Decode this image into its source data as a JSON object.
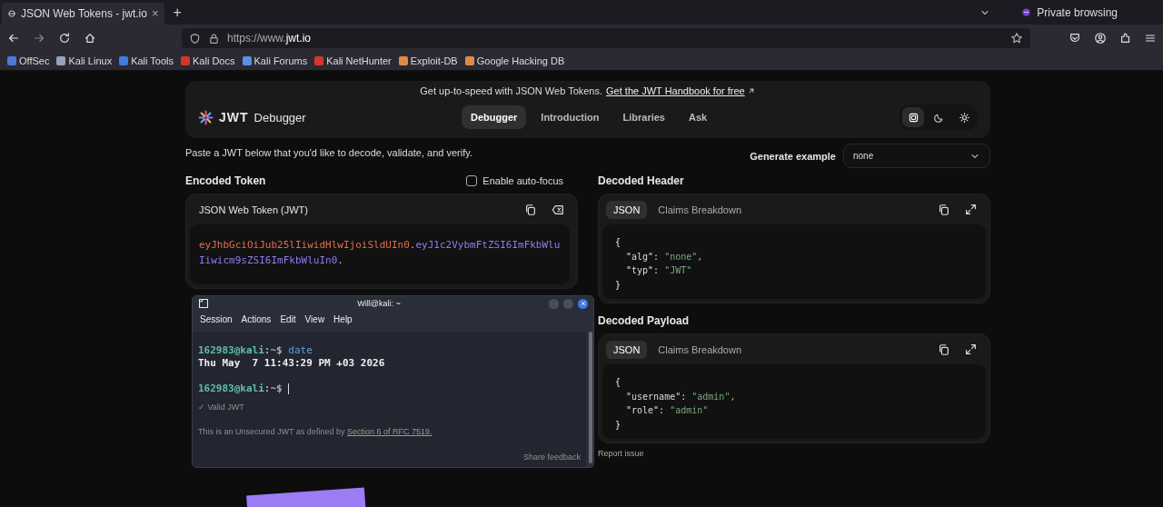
{
  "browser": {
    "tab": {
      "title": "JSON Web Tokens - jwt.io",
      "close": "×",
      "selected": true
    },
    "new_tab": "+",
    "private_label": "Private browsing",
    "url": {
      "prefix": "https://www.",
      "domain": "jwt.io"
    },
    "bookmarks": [
      {
        "label": "OffSec",
        "color": "#4a7bd8"
      },
      {
        "label": "Kali Linux",
        "color": "#9aa3b5"
      },
      {
        "label": "Kali Tools",
        "color": "#3f7be0"
      },
      {
        "label": "Kali Docs",
        "color": "#d9342b"
      },
      {
        "label": "Kali Forums",
        "color": "#5b8fe0"
      },
      {
        "label": "Kali NetHunter",
        "color": "#d9342b"
      },
      {
        "label": "Exploit-DB",
        "color": "#e08a4a"
      },
      {
        "label": "Google Hacking DB",
        "color": "#e08a4a"
      }
    ]
  },
  "banner": {
    "text": "Get up-to-speed with JSON Web Tokens.",
    "link": "Get the JWT Handbook for free"
  },
  "header": {
    "logo": "JWT",
    "title": "Debugger",
    "nav": [
      {
        "label": "Debugger",
        "selected": true
      },
      {
        "label": "Introduction",
        "selected": false
      },
      {
        "label": "Libraries",
        "selected": false
      },
      {
        "label": "Ask",
        "selected": false
      }
    ],
    "theme_buttons": [
      {
        "kind": "system",
        "selected": true
      },
      {
        "kind": "dark",
        "selected": false
      },
      {
        "kind": "light",
        "selected": false
      }
    ]
  },
  "intro": "Paste a JWT below that you'd like to decode, validate, and verify.",
  "generate": {
    "label": "Generate example",
    "value": "none"
  },
  "encoded": {
    "title": "Encoded Token",
    "autofocus": {
      "label": "Enable auto-focus",
      "checked": false
    },
    "panel_title": "JSON Web Token (JWT)",
    "token": [
      {
        "kind": "header",
        "text": "eyJhbGciOiJub25lIiwidHlwIjoiSldUIn0"
      },
      {
        "kind": "dot",
        "text": "."
      },
      {
        "kind": "payload",
        "text": "eyJ1c2VybmFtZSI6ImFkbWluIiwicm9sZSI6ImFkbWluIn0"
      },
      {
        "kind": "dot",
        "text": "."
      }
    ],
    "status": "✓ Valid JWT",
    "note": {
      "text": "This is an Unsecured JWT as defined by",
      "link": "Section 6 of RFC 7519."
    },
    "share_feedback": "Share feedback"
  },
  "decoded_header": {
    "title": "Decoded Header",
    "tabs": [
      {
        "label": "JSON",
        "selected": true
      },
      {
        "label": "Claims Breakdown",
        "selected": false
      }
    ],
    "lines": [
      {
        "kind": "brace",
        "text": "{"
      },
      {
        "kind": "entry",
        "key": "\"alg\":",
        "value": "\"none\"",
        "comma": ","
      },
      {
        "kind": "entry",
        "key": "\"typ\":",
        "value": "\"JWT\""
      },
      {
        "kind": "brace",
        "text": "}"
      }
    ]
  },
  "decoded_payload": {
    "title": "Decoded Payload",
    "tabs": [
      {
        "label": "JSON",
        "selected": true
      },
      {
        "label": "Claims Breakdown",
        "selected": false
      }
    ],
    "lines": [
      {
        "kind": "brace",
        "text": "{"
      },
      {
        "kind": "entry",
        "key": "\"username\":",
        "value": "\"admin\"",
        "comma": ","
      },
      {
        "kind": "entry",
        "key": "\"role\":",
        "value": "\"admin\""
      },
      {
        "kind": "brace",
        "text": "}"
      }
    ]
  },
  "report_issue": "Report issue",
  "terminal": {
    "title": "Will@kali: ~",
    "menu": [
      "Session",
      "Actions",
      "Edit",
      "View",
      "Help"
    ],
    "lines": [
      {
        "kind": "prompt",
        "user": "162983@kali",
        "path": ":~$",
        "command": "date",
        "cursor": false
      },
      {
        "kind": "output",
        "text": "Thu May  7 11:43:29 PM +03 2026"
      },
      {
        "kind": "blank"
      },
      {
        "kind": "prompt",
        "user": "162983@kali",
        "path": ":~$",
        "cursor": true
      }
    ]
  }
}
